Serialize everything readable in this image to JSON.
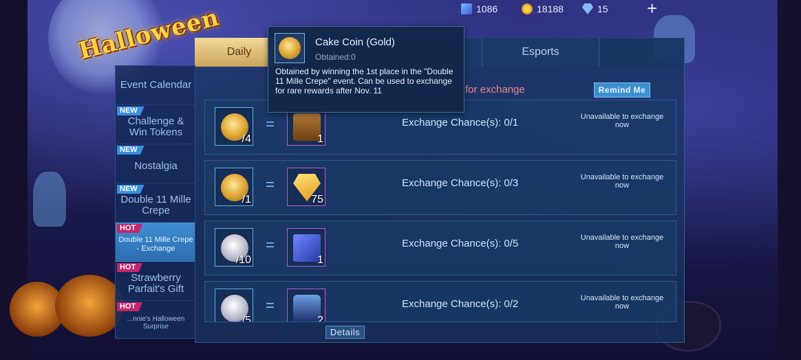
{
  "game": {
    "logo_text": "Halloween"
  },
  "resources": {
    "tickets": "1086",
    "battle_points": "18188",
    "diamonds": "15"
  },
  "tabs": [
    {
      "label": "Daily",
      "active": true
    },
    {
      "label": "",
      "active": false
    },
    {
      "label": "",
      "active": false
    },
    {
      "label": "Esports",
      "active": false
    }
  ],
  "sidebar": {
    "items": [
      {
        "label": "Event Calendar",
        "badge": ""
      },
      {
        "label": "Challenge & Win Tokens",
        "badge": "NEW"
      },
      {
        "label": "Nostalgia",
        "badge": "NEW"
      },
      {
        "label": "Double 11 Mille Crepe",
        "badge": "NEW"
      },
      {
        "label": "Double 11 Mille Crepe - Exchange",
        "badge": "HOT",
        "active": true
      },
      {
        "label": "Strawberry Parfait's Gift",
        "badge": "HOT"
      },
      {
        "label": "...nnie's Halloween Surprise",
        "badge": "HOT"
      }
    ]
  },
  "notice": {
    "text": "for exchange",
    "remind_label": "Remind Me"
  },
  "exchanges": [
    {
      "cost": "/4",
      "reward_qty": "1",
      "reward_icon": "chest-icon",
      "coin_icon": "gold-coin-icon",
      "chance": "Exchange Chance(s): 0/1",
      "status": "Unavailable to exchange now"
    },
    {
      "cost": "/1",
      "reward_qty": "75",
      "reward_icon": "diamond-icon",
      "coin_icon": "gold-coin-icon",
      "chance": "Exchange Chance(s): 0/3",
      "status": "Unavailable to exchange now"
    },
    {
      "cost": "/10",
      "reward_qty": "1",
      "reward_icon": "giftbox-icon",
      "coin_icon": "silver-coin-icon",
      "chance": "Exchange Chance(s): 0/5",
      "status": "Unavailable to exchange now"
    },
    {
      "cost": "/5",
      "reward_qty": "2",
      "reward_icon": "skin-icon",
      "coin_icon": "silver-coin-icon",
      "chance": "Exchange Chance(s): 0/2",
      "status": "Unavailable to exchange now"
    }
  ],
  "details_label": "Details",
  "tooltip": {
    "title": "Cake Coin (Gold)",
    "obtained": "Obtained:0",
    "description": "Obtained by winning the 1st place in the \"Double 11 Mille Crepe\" event. Can be used to exchange for rare rewards after Nov. 11"
  },
  "colors": {
    "accent": "#3d8fd0",
    "hot_badge": "#c2256a",
    "new_badge": "#3a8fe0",
    "notice_text": "#e88a8a"
  }
}
